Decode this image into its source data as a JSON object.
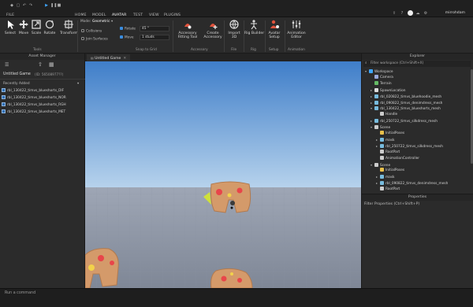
{
  "menubar": {
    "file": "FILE",
    "tabs": [
      "HOME",
      "MODEL",
      "AVATAR",
      "TEST",
      "VIEW",
      "PLUGINS"
    ],
    "active_tab": "AVATAR",
    "user": "mirrohdam"
  },
  "ribbon": {
    "tools": [
      {
        "label": "Select",
        "icon": "cursor-icon"
      },
      {
        "label": "Move",
        "icon": "move-icon"
      },
      {
        "label": "Scale",
        "icon": "scale-icon"
      },
      {
        "label": "Rotate",
        "icon": "rotate-icon"
      },
      {
        "label": "Transform",
        "icon": "transform-icon"
      }
    ],
    "tools_group": "Tools",
    "mode_label": "Mode:",
    "mode_value": "Geometric",
    "collisions_label": "Collisions",
    "join_surfaces_label": "Join Surfaces",
    "rotate_label": "Rotate",
    "rotate_value": "45 °",
    "move_label": "Move",
    "move_value": "1 studs",
    "snap_group": "Snap to Grid",
    "accessory_buttons": [
      {
        "label": "Accessory Fitting Tool",
        "icon": "accessory-fitting-icon"
      },
      {
        "label": "Create Accessory",
        "icon": "create-accessory-icon"
      }
    ],
    "accessory_group": "Accessory",
    "import_label": "Import 3D",
    "file_group": "File",
    "rig_builder_label": "Rig Builder",
    "rig_group": "Rig",
    "avatar_setup_label": "Avatar Setup",
    "setup_group": "Setup",
    "animation_editor_label": "Animation Editor",
    "animation_group": "Animation"
  },
  "asset_manager": {
    "title": "Asset Manager",
    "game_title": "Untitled Game",
    "game_id": "(ID: 56508977??)",
    "section": "Recently Added",
    "items": [
      "rbl_130422_timvs_blueshorts_DIF",
      "rbl_130422_timvs_blueshorts_NOR",
      "rbl_130422_timvs_blueshorts_RGH",
      "rbl_130422_timvs_blueshorts_MET"
    ]
  },
  "viewport": {
    "tab_label": "Untitled Game"
  },
  "explorer": {
    "title": "Explorer",
    "filter_placeholder": "Filter workspace (Ctrl+Shift+X)",
    "tree": [
      {
        "label": "Workspace",
        "icon": "workspace-icon",
        "indent": 0,
        "arrow": "▾",
        "color": "#3ea6ff"
      },
      {
        "label": "Camera",
        "icon": "camera-icon",
        "indent": 1,
        "arrow": "",
        "color": "#9ad"
      },
      {
        "label": "Terrain",
        "icon": "terrain-icon",
        "indent": 1,
        "arrow": "",
        "color": "#6b6"
      },
      {
        "label": "SpawnLocation",
        "icon": "spawn-icon",
        "indent": 1,
        "arrow": "▸",
        "color": "#ddd"
      },
      {
        "label": "rbl_020822_timvs_bluehoodie_mesh",
        "icon": "mesh-icon",
        "indent": 1,
        "arrow": "▸",
        "color": "#7bd"
      },
      {
        "label": "rbl_090822_timvs_denimdress_mesh",
        "icon": "mesh-icon",
        "indent": 1,
        "arrow": "▸",
        "color": "#7bd"
      },
      {
        "label": "rbl_130422_timvs_blueshorts_mesh",
        "icon": "mesh-icon",
        "indent": 1,
        "arrow": "▾",
        "color": "#7bd"
      },
      {
        "label": "Handle",
        "icon": "handle-icon",
        "indent": 2,
        "arrow": "",
        "color": "#ccc"
      },
      {
        "label": "rbl_250722_timvs_silkdress_mesh",
        "icon": "mesh-icon",
        "indent": 1,
        "arrow": "▸",
        "color": "#7bd"
      },
      {
        "label": "Scene",
        "icon": "model-icon",
        "indent": 1,
        "arrow": "▾",
        "color": "#ccc"
      },
      {
        "label": "InitialPoses",
        "icon": "folder-icon",
        "indent": 2,
        "arrow": "",
        "color": "#e8c04a"
      },
      {
        "label": "mask",
        "icon": "mesh-icon",
        "indent": 2,
        "arrow": "▸",
        "color": "#7bd"
      },
      {
        "label": "rbl_250722_timvs_silkdress_mesh",
        "icon": "mesh-icon",
        "indent": 2,
        "arrow": "▸",
        "color": "#7bd"
      },
      {
        "label": "RootPart",
        "icon": "part-icon",
        "indent": 2,
        "arrow": "",
        "color": "#ccc"
      },
      {
        "label": "AnimationController",
        "icon": "animation-controller-icon",
        "indent": 2,
        "arrow": "",
        "color": "#ccc"
      },
      {
        "label": "Scene",
        "icon": "model-icon",
        "indent": 1,
        "arrow": "▾",
        "color": "#ccc"
      },
      {
        "label": "InitialPoses",
        "icon": "folder-icon",
        "indent": 2,
        "arrow": "",
        "color": "#e8c04a"
      },
      {
        "label": "mask",
        "icon": "mesh-icon",
        "indent": 2,
        "arrow": "▸",
        "color": "#7bd"
      },
      {
        "label": "rbl_090822_timvs_denimdress_mesh",
        "icon": "mesh-icon",
        "indent": 2,
        "arrow": "▸",
        "color": "#7bd"
      },
      {
        "label": "RootPart",
        "icon": "part-icon",
        "indent": 2,
        "arrow": "",
        "color": "#ccc"
      }
    ]
  },
  "properties": {
    "title": "Properties",
    "filter_placeholder": "Filter Properties (Ctrl+Shift+P)"
  },
  "command_bar": {
    "placeholder": "Run a command"
  },
  "colors": {
    "accent": "#3ea6ff",
    "sky_top": "#3f7ec9",
    "sky_bottom": "#b6d2ec",
    "floor": "#8c93a2"
  }
}
